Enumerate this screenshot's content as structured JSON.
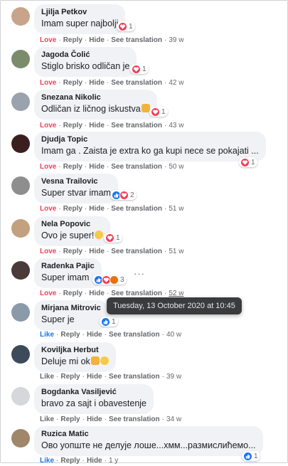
{
  "labels": {
    "like": "Like",
    "love": "Love",
    "reply": "Reply",
    "hide": "Hide",
    "see_translation": "See translation"
  },
  "tooltip": "Tuesday, 13 October 2020 at 10:45",
  "comments": [
    {
      "name": "Ljilja Petkov",
      "text": "Imam super najbolji",
      "reaction_state": "Love",
      "time": "39 w",
      "react_count": "1",
      "avatar_color": "#c7a48a",
      "reactions": [
        "heart"
      ]
    },
    {
      "name": "Jagoda Čolić",
      "text": "Stiglo brisko odličan je",
      "reaction_state": "Love",
      "time": "42 w",
      "react_count": "1",
      "avatar_color": "#7b8c6a",
      "reactions": [
        "heart"
      ]
    },
    {
      "name": "Snezana Nikolic",
      "text": "Odličan iz ličnog iskustva",
      "reaction_state": "Love",
      "time": "43 w",
      "react_count": "1",
      "avatar_color": "#9aa3ad",
      "reactions": [
        "heart"
      ]
    },
    {
      "name": "Djudja Topic",
      "text": "Imam ga . Zaista je extra ko ga kupi nece se pokajati ...",
      "reaction_state": "Love",
      "time": "50 w",
      "react_count": "1",
      "avatar_color": "#3b1f1f",
      "reactions": [
        "heart"
      ]
    },
    {
      "name": "Vesna Trailovic",
      "text": "Super stvar imam",
      "reaction_state": "Love",
      "time": "51 w",
      "react_count": "2",
      "avatar_color": "#8e8e8e",
      "reactions": [
        "like",
        "heart"
      ]
    },
    {
      "name": "Nela Popovic",
      "text": "Ovo je super!",
      "reaction_state": "Love",
      "time": "51 w",
      "react_count": "1",
      "avatar_color": "#c2a080",
      "reactions": [
        "heart"
      ]
    },
    {
      "name": "Radenka Pajic",
      "text": "Super imam",
      "reaction_state": "Love",
      "time": "52 w",
      "react_count": "3",
      "avatar_color": "#4a3a3a",
      "reactions": [
        "like",
        "heart",
        "angry"
      ]
    },
    {
      "name": "Mirjana Mitrovic",
      "text": "Super je",
      "reaction_state": "Like",
      "time": "40 w",
      "react_count": "1",
      "avatar_color": "#8a9aa8",
      "reactions": [
        "like"
      ]
    },
    {
      "name": "Koviljka Herbut",
      "text": "Deluje mi ok",
      "reaction_state": "",
      "time": "39 w",
      "react_count": "",
      "avatar_color": "#3c4a5a",
      "reactions": []
    },
    {
      "name": "Bogdanka Vasiljević",
      "text": "bravo za sajt i obavestenje",
      "reaction_state": "",
      "time": "34 w",
      "react_count": "",
      "avatar_color": "#d5d7db",
      "reactions": []
    },
    {
      "name": "Ruzica Matic",
      "text": "Ово уопште не делује лоше...хмм...размислићемо...",
      "reaction_state": "Like",
      "time": "1 y",
      "react_count": "1",
      "avatar_color": "#a0866a",
      "reactions": [
        "like"
      ]
    }
  ]
}
